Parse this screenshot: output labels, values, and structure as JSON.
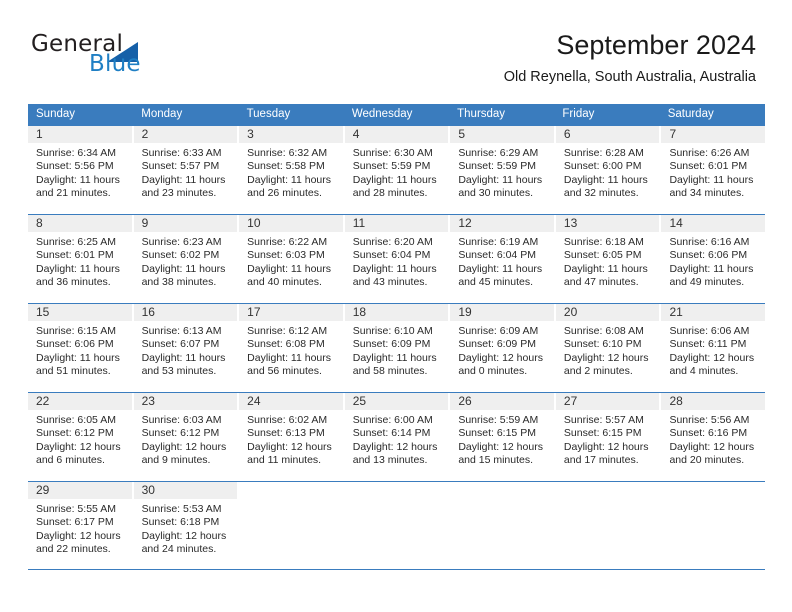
{
  "brand": {
    "name_part1": "General",
    "name_part2": "Blue",
    "triangle_color": "#1560a8",
    "blue_color": "#1f7fc4"
  },
  "header": {
    "title": "September 2024",
    "subtitle": "Old Reynella, South Australia, Australia",
    "header_bg": "#3a7cbe",
    "daynum_bg": "#efefef"
  },
  "weekdays": [
    "Sunday",
    "Monday",
    "Tuesday",
    "Wednesday",
    "Thursday",
    "Friday",
    "Saturday"
  ],
  "labels": {
    "sunrise_prefix": "Sunrise:",
    "sunset_prefix": "Sunset:",
    "daylight_prefix": "Daylight:"
  },
  "weeks": [
    [
      {
        "day": "1",
        "sunrise": "Sunrise: 6:34 AM",
        "sunset": "Sunset: 5:56 PM",
        "daylight1": "Daylight: 11 hours",
        "daylight2": "and 21 minutes."
      },
      {
        "day": "2",
        "sunrise": "Sunrise: 6:33 AM",
        "sunset": "Sunset: 5:57 PM",
        "daylight1": "Daylight: 11 hours",
        "daylight2": "and 23 minutes."
      },
      {
        "day": "3",
        "sunrise": "Sunrise: 6:32 AM",
        "sunset": "Sunset: 5:58 PM",
        "daylight1": "Daylight: 11 hours",
        "daylight2": "and 26 minutes."
      },
      {
        "day": "4",
        "sunrise": "Sunrise: 6:30 AM",
        "sunset": "Sunset: 5:59 PM",
        "daylight1": "Daylight: 11 hours",
        "daylight2": "and 28 minutes."
      },
      {
        "day": "5",
        "sunrise": "Sunrise: 6:29 AM",
        "sunset": "Sunset: 5:59 PM",
        "daylight1": "Daylight: 11 hours",
        "daylight2": "and 30 minutes."
      },
      {
        "day": "6",
        "sunrise": "Sunrise: 6:28 AM",
        "sunset": "Sunset: 6:00 PM",
        "daylight1": "Daylight: 11 hours",
        "daylight2": "and 32 minutes."
      },
      {
        "day": "7",
        "sunrise": "Sunrise: 6:26 AM",
        "sunset": "Sunset: 6:01 PM",
        "daylight1": "Daylight: 11 hours",
        "daylight2": "and 34 minutes."
      }
    ],
    [
      {
        "day": "8",
        "sunrise": "Sunrise: 6:25 AM",
        "sunset": "Sunset: 6:01 PM",
        "daylight1": "Daylight: 11 hours",
        "daylight2": "and 36 minutes."
      },
      {
        "day": "9",
        "sunrise": "Sunrise: 6:23 AM",
        "sunset": "Sunset: 6:02 PM",
        "daylight1": "Daylight: 11 hours",
        "daylight2": "and 38 minutes."
      },
      {
        "day": "10",
        "sunrise": "Sunrise: 6:22 AM",
        "sunset": "Sunset: 6:03 PM",
        "daylight1": "Daylight: 11 hours",
        "daylight2": "and 40 minutes."
      },
      {
        "day": "11",
        "sunrise": "Sunrise: 6:20 AM",
        "sunset": "Sunset: 6:04 PM",
        "daylight1": "Daylight: 11 hours",
        "daylight2": "and 43 minutes."
      },
      {
        "day": "12",
        "sunrise": "Sunrise: 6:19 AM",
        "sunset": "Sunset: 6:04 PM",
        "daylight1": "Daylight: 11 hours",
        "daylight2": "and 45 minutes."
      },
      {
        "day": "13",
        "sunrise": "Sunrise: 6:18 AM",
        "sunset": "Sunset: 6:05 PM",
        "daylight1": "Daylight: 11 hours",
        "daylight2": "and 47 minutes."
      },
      {
        "day": "14",
        "sunrise": "Sunrise: 6:16 AM",
        "sunset": "Sunset: 6:06 PM",
        "daylight1": "Daylight: 11 hours",
        "daylight2": "and 49 minutes."
      }
    ],
    [
      {
        "day": "15",
        "sunrise": "Sunrise: 6:15 AM",
        "sunset": "Sunset: 6:06 PM",
        "daylight1": "Daylight: 11 hours",
        "daylight2": "and 51 minutes."
      },
      {
        "day": "16",
        "sunrise": "Sunrise: 6:13 AM",
        "sunset": "Sunset: 6:07 PM",
        "daylight1": "Daylight: 11 hours",
        "daylight2": "and 53 minutes."
      },
      {
        "day": "17",
        "sunrise": "Sunrise: 6:12 AM",
        "sunset": "Sunset: 6:08 PM",
        "daylight1": "Daylight: 11 hours",
        "daylight2": "and 56 minutes."
      },
      {
        "day": "18",
        "sunrise": "Sunrise: 6:10 AM",
        "sunset": "Sunset: 6:09 PM",
        "daylight1": "Daylight: 11 hours",
        "daylight2": "and 58 minutes."
      },
      {
        "day": "19",
        "sunrise": "Sunrise: 6:09 AM",
        "sunset": "Sunset: 6:09 PM",
        "daylight1": "Daylight: 12 hours",
        "daylight2": "and 0 minutes."
      },
      {
        "day": "20",
        "sunrise": "Sunrise: 6:08 AM",
        "sunset": "Sunset: 6:10 PM",
        "daylight1": "Daylight: 12 hours",
        "daylight2": "and 2 minutes."
      },
      {
        "day": "21",
        "sunrise": "Sunrise: 6:06 AM",
        "sunset": "Sunset: 6:11 PM",
        "daylight1": "Daylight: 12 hours",
        "daylight2": "and 4 minutes."
      }
    ],
    [
      {
        "day": "22",
        "sunrise": "Sunrise: 6:05 AM",
        "sunset": "Sunset: 6:12 PM",
        "daylight1": "Daylight: 12 hours",
        "daylight2": "and 6 minutes."
      },
      {
        "day": "23",
        "sunrise": "Sunrise: 6:03 AM",
        "sunset": "Sunset: 6:12 PM",
        "daylight1": "Daylight: 12 hours",
        "daylight2": "and 9 minutes."
      },
      {
        "day": "24",
        "sunrise": "Sunrise: 6:02 AM",
        "sunset": "Sunset: 6:13 PM",
        "daylight1": "Daylight: 12 hours",
        "daylight2": "and 11 minutes."
      },
      {
        "day": "25",
        "sunrise": "Sunrise: 6:00 AM",
        "sunset": "Sunset: 6:14 PM",
        "daylight1": "Daylight: 12 hours",
        "daylight2": "and 13 minutes."
      },
      {
        "day": "26",
        "sunrise": "Sunrise: 5:59 AM",
        "sunset": "Sunset: 6:15 PM",
        "daylight1": "Daylight: 12 hours",
        "daylight2": "and 15 minutes."
      },
      {
        "day": "27",
        "sunrise": "Sunrise: 5:57 AM",
        "sunset": "Sunset: 6:15 PM",
        "daylight1": "Daylight: 12 hours",
        "daylight2": "and 17 minutes."
      },
      {
        "day": "28",
        "sunrise": "Sunrise: 5:56 AM",
        "sunset": "Sunset: 6:16 PM",
        "daylight1": "Daylight: 12 hours",
        "daylight2": "and 20 minutes."
      }
    ],
    [
      {
        "day": "29",
        "sunrise": "Sunrise: 5:55 AM",
        "sunset": "Sunset: 6:17 PM",
        "daylight1": "Daylight: 12 hours",
        "daylight2": "and 22 minutes."
      },
      {
        "day": "30",
        "sunrise": "Sunrise: 5:53 AM",
        "sunset": "Sunset: 6:18 PM",
        "daylight1": "Daylight: 12 hours",
        "daylight2": "and 24 minutes."
      },
      {
        "day": "",
        "sunrise": "",
        "sunset": "",
        "daylight1": "",
        "daylight2": ""
      },
      {
        "day": "",
        "sunrise": "",
        "sunset": "",
        "daylight1": "",
        "daylight2": ""
      },
      {
        "day": "",
        "sunrise": "",
        "sunset": "",
        "daylight1": "",
        "daylight2": ""
      },
      {
        "day": "",
        "sunrise": "",
        "sunset": "",
        "daylight1": "",
        "daylight2": ""
      },
      {
        "day": "",
        "sunrise": "",
        "sunset": "",
        "daylight1": "",
        "daylight2": ""
      }
    ]
  ]
}
